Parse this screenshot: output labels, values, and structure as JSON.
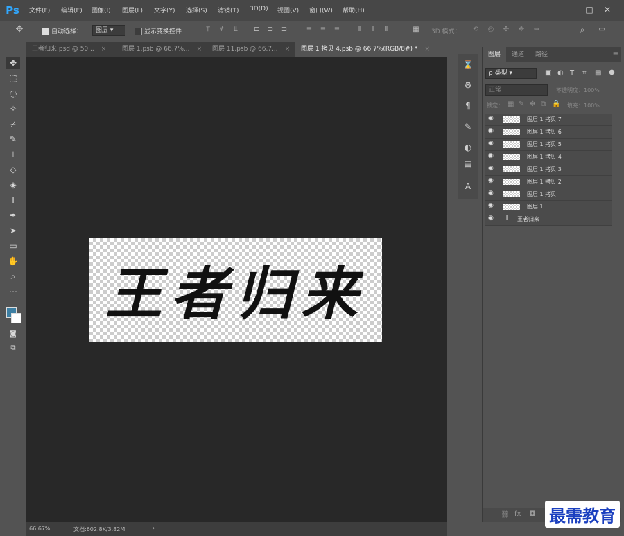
{
  "app": {
    "logo": "Ps"
  },
  "menu": [
    "文件(F)",
    "编辑(E)",
    "图像(I)",
    "图层(L)",
    "文字(Y)",
    "选择(S)",
    "滤镜(T)",
    "3D(D)",
    "视图(V)",
    "窗口(W)",
    "帮助(H)"
  ],
  "window_controls": [
    "—",
    "□",
    "✕"
  ],
  "options": {
    "auto_select": "自动选择：",
    "auto_select_target": "图层",
    "show_transform": "显示变换控件",
    "mode3d": "3D 模式："
  },
  "tabs": [
    {
      "label": "王者归来.psd @ 50...",
      "close": "×"
    },
    {
      "label": "图层 1.psb @ 66.7%...",
      "close": "×"
    },
    {
      "label": "图层 11.psb @ 66.7...",
      "close": "×"
    },
    {
      "label": "图层 1 拷贝 4.psb @ 66.7%(RGB/8#) *",
      "close": "×"
    }
  ],
  "canvas": {
    "text": "王者归来"
  },
  "status": {
    "zoom": "66.67%",
    "doc": "文档:602.8K/3.82M"
  },
  "panel": {
    "tabs": [
      "图层",
      "通道",
      "路径"
    ],
    "filter": "ρ 类型",
    "blend": "正常",
    "opacity": "不透明度：100%",
    "lock": "锁定：",
    "fill": "填充：100%",
    "layers": [
      "图层 1 拷贝 7",
      "图层 1 拷贝 6",
      "图层 1 拷贝 5",
      "图层 1 拷贝 4",
      "图层 1 拷贝 3",
      "图层 1 拷贝 2",
      "图层 1 拷贝",
      "图层 1"
    ],
    "text_layer": "王者归来",
    "text_layer_icon": "T"
  },
  "watermark": "最需教育"
}
